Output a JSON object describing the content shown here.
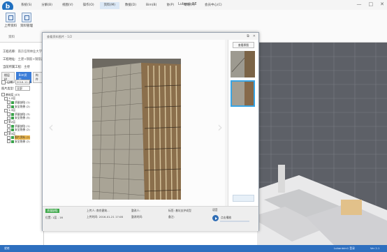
{
  "window": {
    "title": "Lubanb BE",
    "logo_letter": "b",
    "controls": [
      "—",
      "□",
      "✕"
    ]
  },
  "menu": {
    "items": [
      {
        "label": "系统(S)",
        "active": false
      },
      {
        "label": "分解(B)",
        "active": false
      },
      {
        "label": "视图(V)",
        "active": false
      },
      {
        "label": "操作(O)",
        "active": false
      },
      {
        "label": "资料(M)",
        "active": true
      },
      {
        "label": "数据(D)",
        "active": false
      },
      {
        "label": "Bim(B)",
        "active": false
      },
      {
        "label": "协(P)",
        "active": false
      },
      {
        "label": "帮助(H)",
        "active": false
      },
      {
        "label": "会员中心(C)",
        "active": false
      }
    ]
  },
  "ribbon": {
    "buttons": [
      {
        "label": "上传资料",
        "icon": "upload-doc-icon"
      },
      {
        "label": "资料管理",
        "icon": "doc-manage-icon"
      }
    ],
    "group_label": "资料"
  },
  "left_panel": {
    "info": [
      {
        "key": "工程名称:",
        "value": "南京信明林业大学综合"
      },
      {
        "key": "工程地址:",
        "value": "土建+钢筋+钢筋造量"
      },
      {
        "key": "当前所属工程:",
        "value": "主楼"
      }
    ],
    "tabs": [
      "楼层树",
      "Bim资料",
      "构件"
    ],
    "filter_label": "日期:",
    "filter_value": "2016-12-21",
    "type_label": "图片类型:",
    "type_value": "全部",
    "tree": [
      {
        "label": "基础层 (43)",
        "level": 0,
        "kind": "folder"
      },
      {
        "label": "1-2层",
        "level": 1,
        "kind": "folder"
      },
      {
        "label": "质量缺陷 (1)",
        "level": 2,
        "kind": "green"
      },
      {
        "label": "安全隐患 (2)",
        "level": 2,
        "kind": "green"
      },
      {
        "label": "1-3层",
        "level": 1,
        "kind": "folder"
      },
      {
        "label": "质量缺陷 (3)",
        "level": 2,
        "kind": "green"
      },
      {
        "label": "安全隐患 (5)",
        "level": 2,
        "kind": "green"
      },
      {
        "label": "第2层",
        "level": 1,
        "kind": "folder"
      },
      {
        "label": "质量缺陷 (1)",
        "level": 2,
        "kind": "green"
      },
      {
        "label": "安全隐患 (2)",
        "level": 2,
        "kind": "green"
      },
      {
        "label": "第3层",
        "level": 1,
        "kind": "folder"
      },
      {
        "label": "图片资料 (2)",
        "level": 2,
        "kind": "highlight"
      },
      {
        "label": "安全隐患 (2)",
        "level": 2,
        "kind": "green"
      }
    ]
  },
  "dialog": {
    "title": "查看资料图片 - 1/2",
    "controls": [
      "⧉",
      "✕"
    ],
    "prev_arrow": "‹",
    "next_arrow": "›",
    "view_original_label": "查看原图",
    "status_badge": "质量缺陷",
    "location": "位置: 1层 - 16",
    "uploader": "上传人: 南京建筑...",
    "upload_time": "上传时间: 2016-01-21 17:08",
    "inspector": "整改人:",
    "inspect_date": "整改时间:",
    "label_field": "标签: 基坑支护成型",
    "remark_field": "备注:",
    "audio_title": "语音",
    "audio_label": "点击播放"
  },
  "status_bar": {
    "left": "就绪",
    "right_user": "Lubanbim1 登录",
    "right_version": "Ver 2.1"
  }
}
